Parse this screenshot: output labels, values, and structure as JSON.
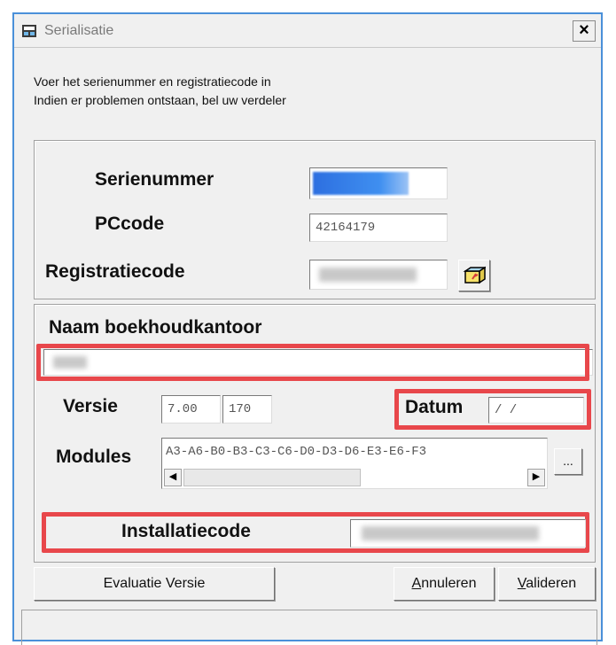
{
  "window": {
    "title": "Serialisatie",
    "close_label": "×"
  },
  "instructions": {
    "line1": "Voer het serienummer en registratiecode in",
    "line2": "Indien er problemen ontstaan, bel uw verdeler"
  },
  "registration": {
    "serienummer_label": "Serienummer",
    "serienummer_value": "",
    "pccode_label": "PCcode",
    "pccode_value": "42164179",
    "registratiecode_label": "Registratiecode",
    "registratiecode_value": "",
    "paste_icon": "paste-icon"
  },
  "office": {
    "naam_label": "Naam boekhoudkantoor",
    "naam_value": "",
    "versie_label": "Versie",
    "versie_major": "7.00",
    "versie_build": "170",
    "datum_label": "Datum",
    "datum_value": "/ /",
    "modules_label": "Modules",
    "modules_value": "A3-A6-B0-B3-C3-C6-D0-D3-D6-E3-E6-F3",
    "modules_more": "...",
    "scroll_left": "◀",
    "scroll_right": "▶",
    "installatiecode_label": "Installatiecode",
    "installatiecode_value": ""
  },
  "buttons": {
    "evaluatie": "Evaluatie Versie",
    "annuleren_first": "A",
    "annuleren_rest": "nnuleren",
    "valideren_first": "V",
    "valideren_rest": "alideren"
  },
  "colors": {
    "highlight": "#e8474b",
    "window_border": "#4a90d9",
    "serial_fill": "#2d6fe0"
  }
}
